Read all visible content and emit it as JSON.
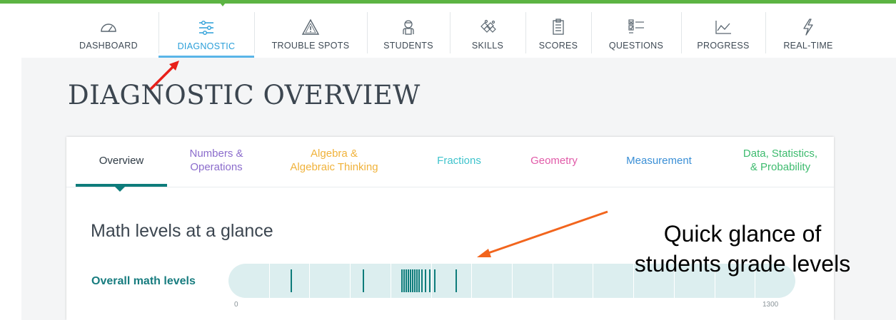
{
  "theme": {
    "top_bar": "#5cb443",
    "active_nav": "#2b9fd9",
    "teal": "#0e7c7b",
    "track": "#dceeef",
    "red_arrow": "#e8201a",
    "orange_arrow": "#f2651d"
  },
  "nav": {
    "items": [
      {
        "label": "DASHBOARD",
        "icon": "gauge-icon"
      },
      {
        "label": "DIAGNOSTIC",
        "icon": "sliders-icon",
        "active": true
      },
      {
        "label": "TROUBLE SPOTS",
        "icon": "warning-icon"
      },
      {
        "label": "STUDENTS",
        "icon": "student-icon"
      },
      {
        "label": "SKILLS",
        "icon": "puzzle-icon"
      },
      {
        "label": "SCORES",
        "icon": "clipboard-icon"
      },
      {
        "label": "QUESTIONS",
        "icon": "checklist-icon"
      },
      {
        "label": "PROGRESS",
        "icon": "line-chart-icon"
      },
      {
        "label": "REAL-TIME",
        "icon": "lightning-icon"
      }
    ]
  },
  "page": {
    "title": "DIAGNOSTIC OVERVIEW"
  },
  "tabs": [
    {
      "line1": "Overview",
      "line2": "",
      "color": "#2e3a44",
      "active": true
    },
    {
      "line1": "Numbers &",
      "line2": "Operations",
      "color": "#8b6ccc"
    },
    {
      "line1": "Algebra &",
      "line2": "Algebraic Thinking",
      "color": "#f0b23a"
    },
    {
      "line1": "Fractions",
      "line2": "",
      "color": "#3ec3cc"
    },
    {
      "line1": "Geometry",
      "line2": "",
      "color": "#e15aa8"
    },
    {
      "line1": "Measurement",
      "line2": "",
      "color": "#3a8fd6"
    },
    {
      "line1": "Data, Statistics,",
      "line2": "& Probability",
      "color": "#3dbb6e"
    }
  ],
  "levels": {
    "heading": "Math levels at a glance",
    "row_label": "Overall math levels",
    "min_label": "0",
    "max_label": "1300",
    "range": [
      0,
      1300
    ],
    "segments": 14,
    "student_levels": [
      110,
      285,
      380,
      385,
      391,
      396,
      401,
      406,
      411,
      416,
      421,
      428,
      437,
      447,
      460,
      512
    ]
  },
  "annotation": {
    "line1": "Quick glance of",
    "line2": "students grade levels"
  }
}
